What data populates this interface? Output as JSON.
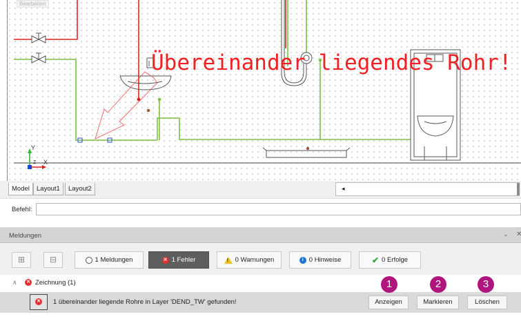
{
  "canvas": {
    "corner_tag": "Bearbeiten",
    "error_annotation": "Übereinander liegendes Rohr!",
    "ucs": {
      "x": "X",
      "y": "Y",
      "z": "Z"
    }
  },
  "layout_tabs": [
    "Model",
    "Layout1",
    "Layout2"
  ],
  "command": {
    "label": "Befehl:",
    "value": ""
  },
  "panel": {
    "title": "Meldungen",
    "filters": {
      "meldungen": "1 Meldungen",
      "fehler": "1 Fehler",
      "warnungen": "0 Warnungen",
      "hinweise": "0 Hinweise",
      "erfolge": "0 Erfolge"
    },
    "group_label": "Zeichnung (1)",
    "message": "1 übereinander liegende Rohre in Layer 'DEND_TW' gefunden!",
    "actions": {
      "show": "Anzeigen",
      "mark": "Markieren",
      "delete": "Löschen"
    },
    "badges": [
      "1",
      "2",
      "3"
    ]
  },
  "colors": {
    "pipe_red": "#e02020",
    "pipe_green": "#7bc143",
    "fehler_active_bg": "#5e5e5e",
    "badge": "#b0157e"
  }
}
